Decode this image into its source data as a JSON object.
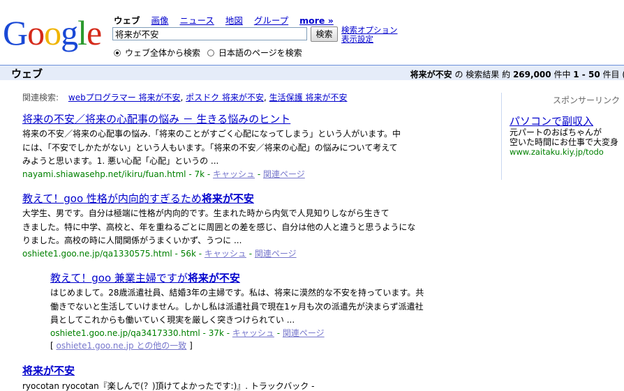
{
  "logo": {
    "letters": [
      "G",
      "o",
      "o",
      "g",
      "l",
      "e"
    ],
    "colors": [
      "#1a49d6",
      "#d52a1a",
      "#f0b400",
      "#1a49d6",
      "#2c9a2e",
      "#d52a1a"
    ]
  },
  "nav": {
    "web": "ウェブ",
    "images": "画像",
    "news": "ニュース",
    "maps": "地図",
    "groups": "グループ",
    "more": "more »"
  },
  "search": {
    "query": "将来が不安",
    "button": "検索",
    "options": "検索オプション",
    "settings": "表示設定"
  },
  "radios": {
    "all_web": "ウェブ全体から検索",
    "japanese": "日本語のページを検索"
  },
  "results_bar": {
    "title": "ウェブ",
    "query": "将来が不安",
    "label": "の 検索結果 約",
    "total": "269,000",
    "range": "件中",
    "range_value": "1 - 50",
    "suffix": "件目 ("
  },
  "related": {
    "label": "関連検索:",
    "items": [
      "webプログラマー 将来が不安",
      "ポスドク 将来が不安",
      "生活保護 将来が不安"
    ]
  },
  "results": [
    {
      "title": "将来の不安／将来の心配事の悩み － 生きる悩みのヒント",
      "lines": [
        "将来の不安／将来の心配事の悩み.「将来のことがすごく心配になってしまう」という人がいます。中",
        "には、「不安でしかたがない」という人もいます。「将来の不安／将来の心配」の悩みについて考えて",
        "みようと思います。1. 悪い心配「心配」というの ..."
      ],
      "url": "nayami.shiawasehp.net/ikiru/fuan.html",
      "size": "7k",
      "cache": "キャッシュ",
      "similar": "関連ページ"
    },
    {
      "title_pre": "教えて！goo 性格が内向的すぎるため",
      "title_bold": "将来が不安",
      "lines": [
        "大学生、男です。自分は極端に性格が内向的です。生まれた時から内気で人見知りしながら生きて",
        "きました。特に中学、高校と、年を重ねるごとに周囲との差を感じ、自分は他の人と違うと思うようにな",
        "りました。高校の時に人間関係がうまくいかず、うつに ..."
      ],
      "url": "oshiete1.goo.ne.jp/qa1330575.html",
      "size": "56k",
      "cache": "キャッシュ",
      "similar": "関連ページ"
    },
    {
      "title_pre": "教えて！goo 兼業主婦ですが",
      "title_bold": "将来が不安",
      "lines": [
        "はじめまして。28歳派遣社員、結婚3年の主婦です。私は、将来に漠然的な不安を持っています。共",
        "働きでないと生活していけません。しかし私は派遣社員で現在1ヶ月も次の派遣先が決まらず派遣社",
        "員としてこれからも働いていく現実を厳しく突きつけられてい ..."
      ],
      "url": "oshiete1.goo.ne.jp/qa3417330.html",
      "size": "37k",
      "cache": "キャッシュ",
      "similar": "関連ページ",
      "more_from": "oshiete1.goo.ne.jp との他の一致"
    },
    {
      "title": "将来が不安",
      "lines": [
        "ryocotan ryocotan『楽しんで(？)頂けてよかったです:)』. トラックバック -"
      ]
    }
  ],
  "sponsored": {
    "heading": "スポンサーリンク",
    "title": "パソコンで副収入",
    "line1": "元パートのおばちゃんが",
    "line2": "空いた時間にお仕事で大変身",
    "url": "www.zaitaku.kiy.jp/todo"
  }
}
